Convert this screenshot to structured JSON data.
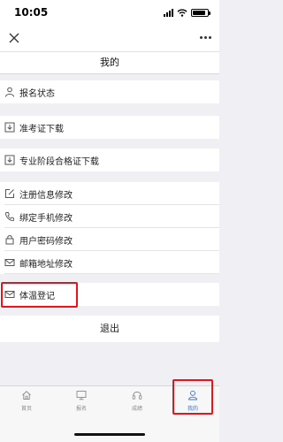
{
  "status_bar": {
    "time": "10:05",
    "signal_icon": "cellular-signal-icon",
    "wifi_icon": "wifi-icon",
    "battery_icon": "battery-icon",
    "battery_level": 0.85
  },
  "nav_bar": {
    "close_icon": "close-icon",
    "more_icon": "more-dots-icon"
  },
  "page": {
    "title": "我的"
  },
  "menu": [
    {
      "label": "报名状态",
      "icon": "person-icon"
    },
    {
      "label": "准考证下载",
      "icon": "download-icon"
    },
    {
      "label": "专业阶段合格证下载",
      "icon": "download-icon"
    },
    {
      "label": "注册信息修改",
      "icon": "edit-icon"
    },
    {
      "label": "绑定手机修改",
      "icon": "phone-icon"
    },
    {
      "label": "用户密码修改",
      "icon": "lock-icon"
    },
    {
      "label": "邮箱地址修改",
      "icon": "mail-icon"
    },
    {
      "label": "体温登记",
      "icon": "envelope-icon"
    }
  ],
  "logout": {
    "label": "退出"
  },
  "tab_bar": {
    "active_index": 3,
    "active_color": "#3b71d6",
    "tabs": [
      {
        "label": "首页",
        "icon": "home-icon"
      },
      {
        "label": "报名",
        "icon": "monitor-icon"
      },
      {
        "label": "成绩",
        "icon": "headset-icon"
      },
      {
        "label": "我的",
        "icon": "user-icon"
      }
    ]
  },
  "highlight_color": "#e8141b"
}
